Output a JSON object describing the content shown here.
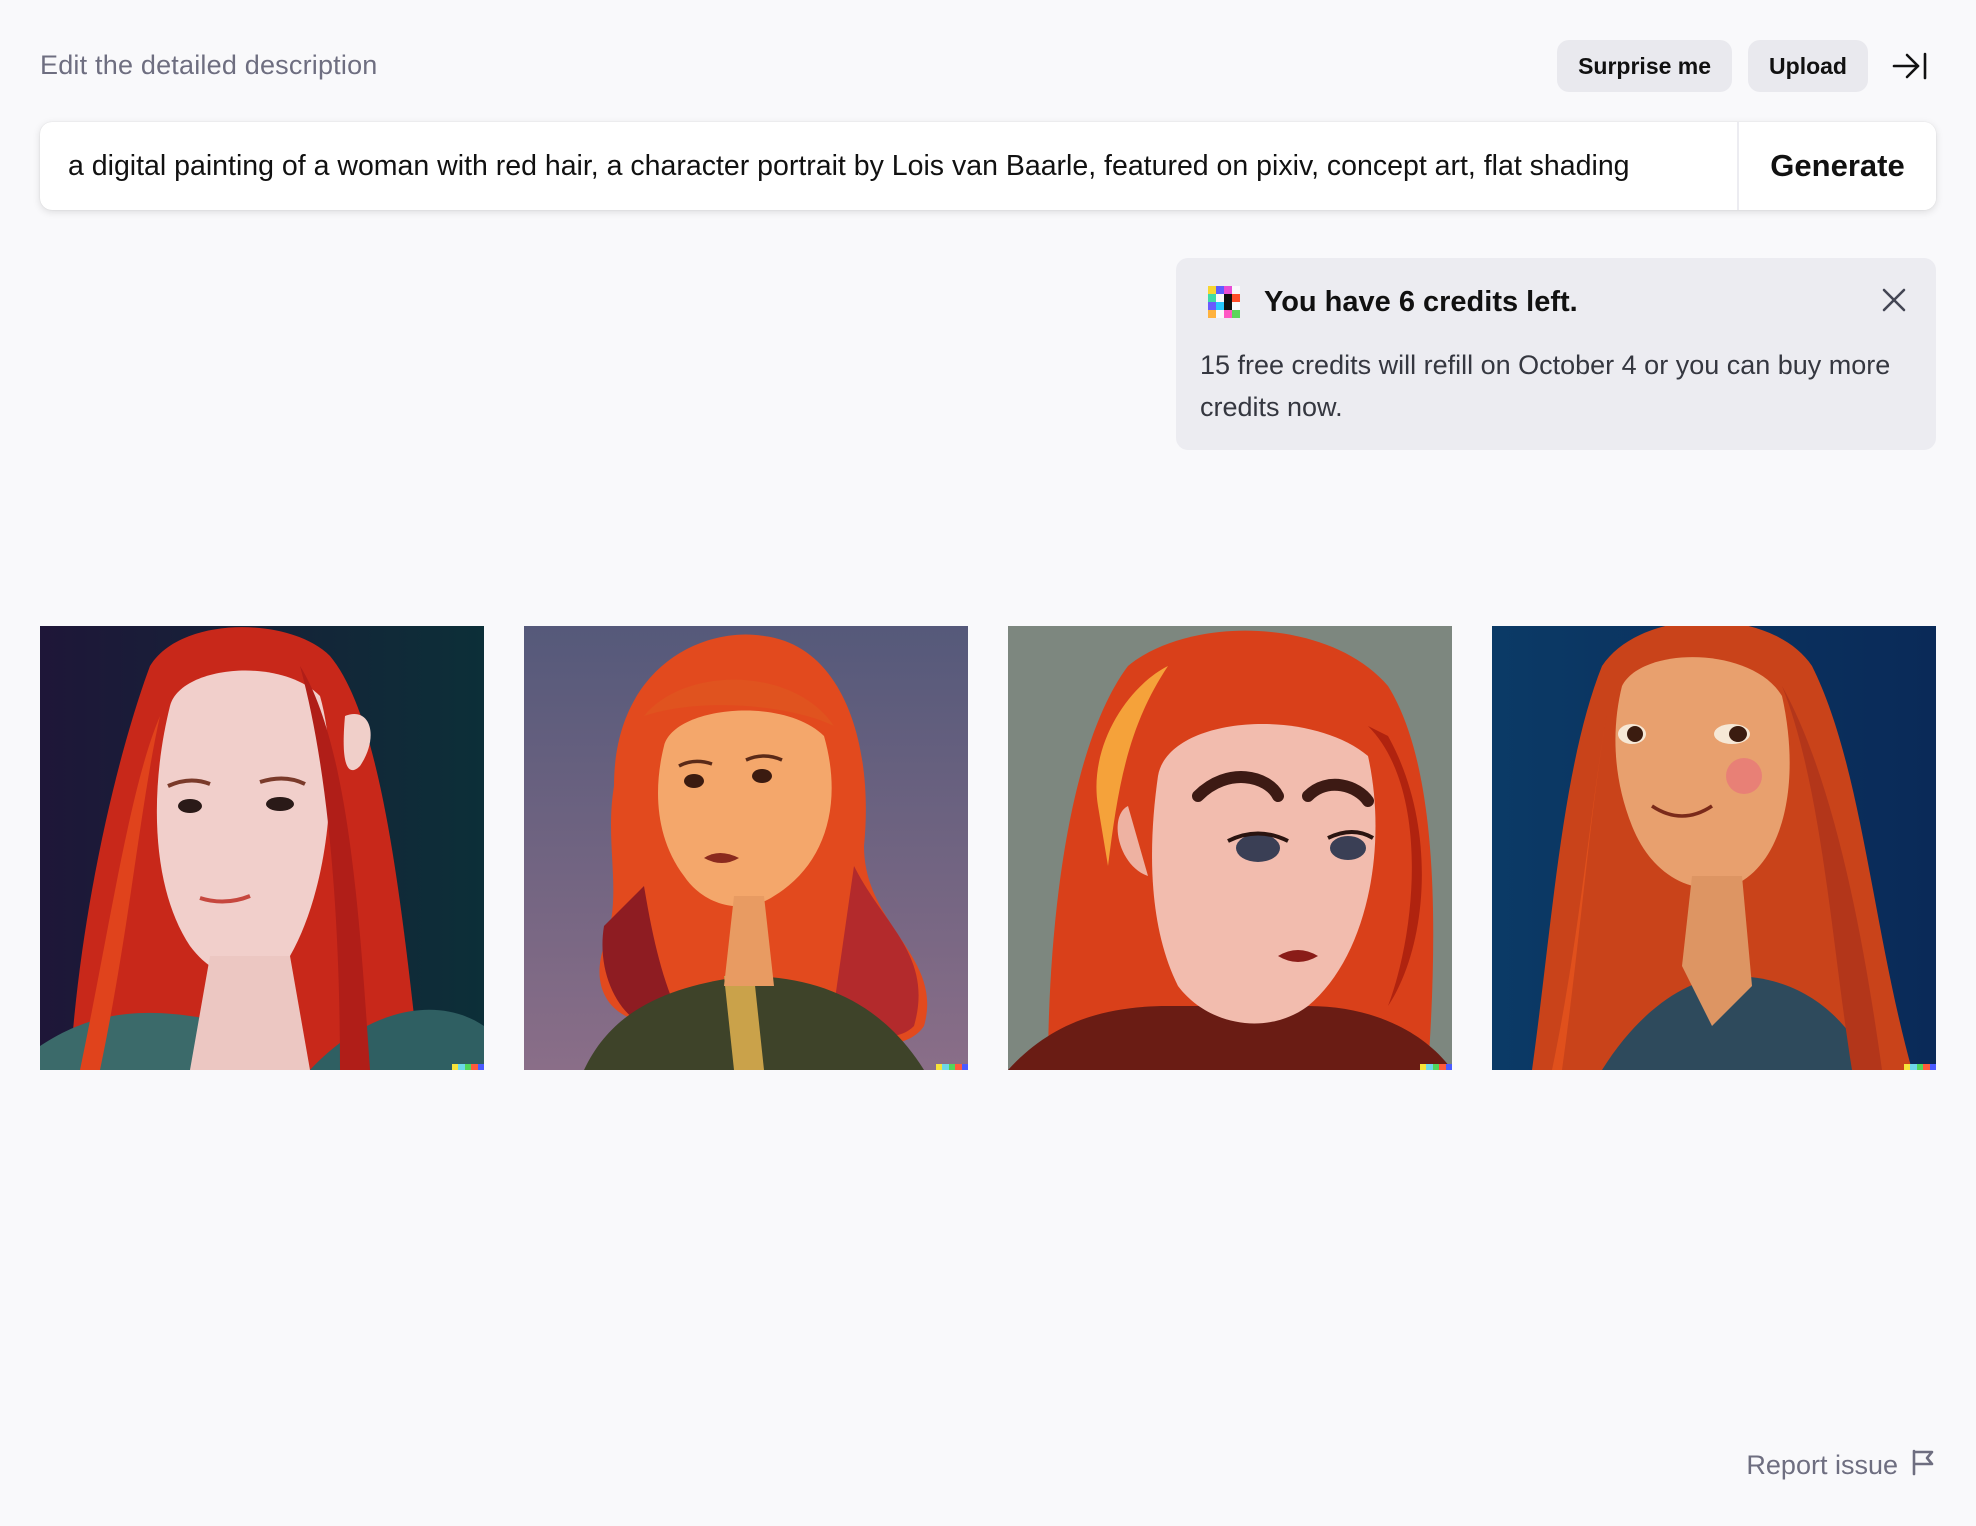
{
  "header": {
    "label": "Edit the detailed description",
    "surprise_label": "Surprise me",
    "upload_label": "Upload"
  },
  "prompt": {
    "value": "a digital painting of a woman with red hair, a character portrait by Lois van Baarle, featured on pixiv, concept art, flat shading",
    "generate_label": "Generate"
  },
  "notice": {
    "title": "You have 6 credits left.",
    "body": "15 free credits will refill on October 4 or you can buy more credits now."
  },
  "images": [
    {
      "name": "generated-image-1",
      "icon": "portrait-image"
    },
    {
      "name": "generated-image-2",
      "icon": "portrait-image"
    },
    {
      "name": "generated-image-3",
      "icon": "portrait-image"
    },
    {
      "name": "generated-image-4",
      "icon": "portrait-image"
    }
  ],
  "footer": {
    "report_label": "Report issue"
  },
  "colors": {
    "background": "#f9f9fb",
    "pill": "#e9e9ee",
    "notice_bg": "#ececf1",
    "muted_text": "#6e6e80"
  },
  "icons": {
    "collapse": "arrow-right-to-line-icon",
    "close": "close-icon",
    "logo": "dalle-pixel-logo-icon",
    "report": "flag-icon"
  }
}
